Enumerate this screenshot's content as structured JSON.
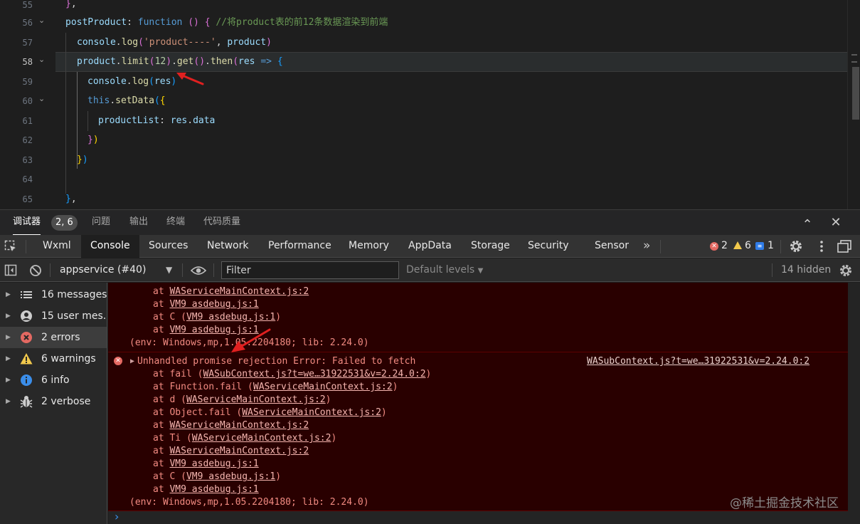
{
  "editor": {
    "lines": [
      {
        "num": "55",
        "text": "},"
      },
      {
        "num": "56",
        "prop": "postProduct",
        "kw": "function",
        "comment": "//将product表的前12条数据渲染到前端"
      },
      {
        "num": "57",
        "text": "console.log('product----', product)"
      },
      {
        "num": "58",
        "text": "product.limit(12).get().then(res => {"
      },
      {
        "num": "59",
        "text": "console.log(res)"
      },
      {
        "num": "60",
        "text": "this.setData({"
      },
      {
        "num": "61",
        "text": "productList: res.data"
      },
      {
        "num": "62",
        "text": "})"
      },
      {
        "num": "63",
        "text": "})"
      },
      {
        "num": "64",
        "text": ""
      },
      {
        "num": "65",
        "text": "},"
      }
    ],
    "fold_glyph": "⌄"
  },
  "panel": {
    "tabs": [
      {
        "label": "调试器",
        "badge": "2, 6"
      },
      {
        "label": "问题"
      },
      {
        "label": "输出"
      },
      {
        "label": "终端"
      },
      {
        "label": "代码质量"
      }
    ],
    "collapse_icon": "⌃",
    "close_icon": "✕"
  },
  "devtools": {
    "tabs": [
      "Wxml",
      "Console",
      "Sources",
      "Network",
      "Performance",
      "Memory",
      "AppData",
      "Storage",
      "Security",
      "Sensor"
    ],
    "active_tab": "Console",
    "more_icon": "»",
    "error_count": "2",
    "warning_count": "6",
    "info_count": "1"
  },
  "toolbar": {
    "context": "appservice (#40)",
    "filter_placeholder": "Filter",
    "levels": "Default levels",
    "hidden": "14 hidden"
  },
  "sidebar": {
    "items": [
      {
        "label": "16 messages",
        "icon": "list-icon"
      },
      {
        "label": "15 user mes...",
        "icon": "user-icon"
      },
      {
        "label": "2 errors",
        "icon": "error-icon"
      },
      {
        "label": "6 warnings",
        "icon": "warning-icon"
      },
      {
        "label": "6 info",
        "icon": "info-icon"
      },
      {
        "label": "2 verbose",
        "icon": "bug-icon"
      }
    ]
  },
  "log": {
    "top_trace": [
      {
        "at": "at ",
        "link": "WAServiceMainContext.js:2"
      },
      {
        "at": "at ",
        "link": "VM9 asdebug.js:1"
      },
      {
        "at": "at C (",
        "link": "VM9 asdebug.js:1",
        "after": ")"
      },
      {
        "at": "at ",
        "link": "VM9 asdebug.js:1"
      }
    ],
    "top_env": "(env: Windows,mp,1.05.2204180; lib: 2.24.0)",
    "error_message": "Unhandled promise rejection Error: Failed to fetch",
    "error_source": "WASubContext.js?t=we…31922531&v=2.24.0:2",
    "trace": [
      {
        "at": "at fail (",
        "link": "WASubContext.js?t=we…31922531&v=2.24.0:2",
        "after": ")"
      },
      {
        "at": "at Function.fail (",
        "link": "WAServiceMainContext.js:2",
        "after": ")"
      },
      {
        "at": "at d (",
        "link": "WAServiceMainContext.js:2",
        "after": ")"
      },
      {
        "at": "at Object.fail (",
        "link": "WAServiceMainContext.js:2",
        "after": ")"
      },
      {
        "at": "at ",
        "link": "WAServiceMainContext.js:2"
      },
      {
        "at": "at Ti (",
        "link": "WAServiceMainContext.js:2",
        "after": ")"
      },
      {
        "at": "at ",
        "link": "WAServiceMainContext.js:2"
      },
      {
        "at": "at ",
        "link": "VM9 asdebug.js:1"
      },
      {
        "at": "at C (",
        "link": "VM9 asdebug.js:1",
        "after": ")"
      },
      {
        "at": "at ",
        "link": "VM9 asdebug.js:1"
      }
    ],
    "env": "(env: Windows,mp,1.05.2204180; lib: 2.24.0)",
    "prompt": "›"
  },
  "watermark": "@稀土掘金技术社区",
  "colors": {
    "error_bg": "#290000",
    "error_text": "#f28b82",
    "annotation_arrow": "#e02020"
  }
}
